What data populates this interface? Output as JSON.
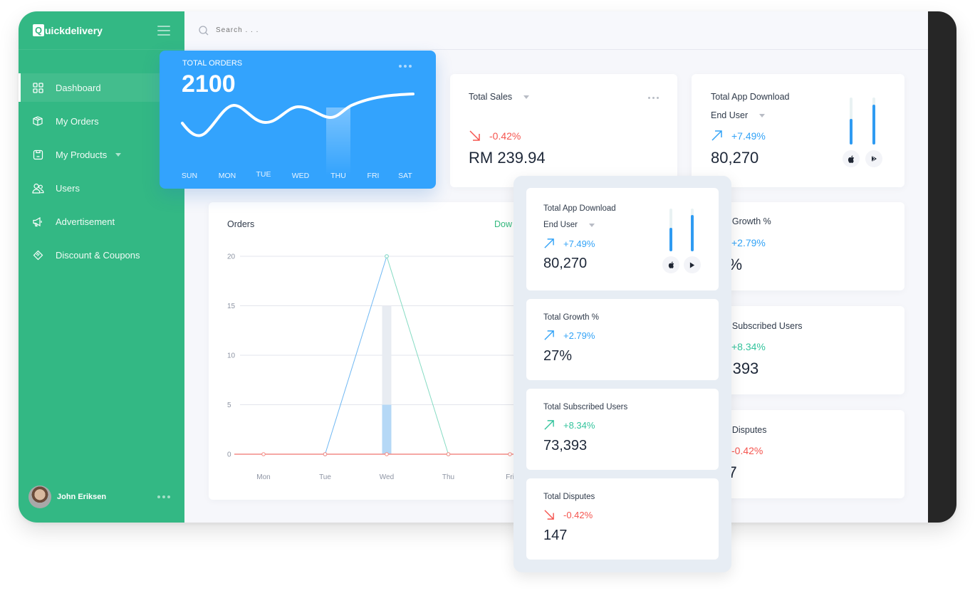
{
  "app": {
    "brand_letter": "Q",
    "brand_rest": "uickdelivery"
  },
  "sidebar": {
    "items": [
      {
        "label": "Dashboard",
        "icon": "grid-icon",
        "active": true
      },
      {
        "label": "My Orders",
        "icon": "box-icon"
      },
      {
        "label": "My Products",
        "icon": "product-icon",
        "has_caret": true
      },
      {
        "label": "Users",
        "icon": "users-icon"
      },
      {
        "label": "Advertisement",
        "icon": "megaphone-icon"
      },
      {
        "label": "Discount & Coupons",
        "icon": "tag-icon"
      }
    ],
    "user": {
      "name": "John Eriksen"
    }
  },
  "topbar": {
    "search_placeholder": "Search . . ."
  },
  "total_orders": {
    "label": "TOTAL ORDERS",
    "value": "2100",
    "days": [
      "SUN",
      "MON",
      "TUE",
      "WED",
      "THU",
      "FRI",
      "SAT"
    ],
    "highlight_day": "THU"
  },
  "total_sales": {
    "title": "Total Sales",
    "change": "-0.42%",
    "value": "RM 239.94"
  },
  "app_download": {
    "title": "Total App Download",
    "filter": "End User",
    "change": "+7.49%",
    "value": "80,270",
    "bars": {
      "ios": 0.55,
      "android": 0.85
    }
  },
  "growth": {
    "title": "Total Growth %",
    "change": "+2.79%",
    "value": "27%"
  },
  "subscribed": {
    "title": "Total Subscribed Users",
    "change": "+8.34%",
    "value": "73,393"
  },
  "disputes": {
    "title": "Total Disputes",
    "change": "-0.42%",
    "value": "147"
  },
  "orders_chart": {
    "title": "Orders",
    "download_label": "Download",
    "download_visible": "Dow"
  },
  "colors": {
    "green": "#33b884",
    "blue": "#33a3fd",
    "red": "#f5554f",
    "teal": "#34c49d"
  },
  "chart_data": {
    "type": "line",
    "title": "Orders",
    "categories": [
      "Mon",
      "Tue",
      "Wed",
      "Thu",
      "Fri"
    ],
    "ylim": [
      0,
      20
    ],
    "yticks": [
      0,
      5,
      10,
      15,
      20
    ],
    "series": [
      {
        "name": "series-blue",
        "color": "#6fb8f3",
        "values": [
          null,
          0,
          20,
          null,
          null
        ]
      },
      {
        "name": "series-teal",
        "color": "#86dbc3",
        "values": [
          null,
          null,
          20,
          0,
          null
        ]
      },
      {
        "name": "series-red",
        "color": "#f48c85",
        "values": [
          0,
          0,
          0,
          0,
          0
        ]
      }
    ],
    "bar": {
      "category": "Wed",
      "background_value": 15,
      "value": 5
    },
    "grid": true
  }
}
